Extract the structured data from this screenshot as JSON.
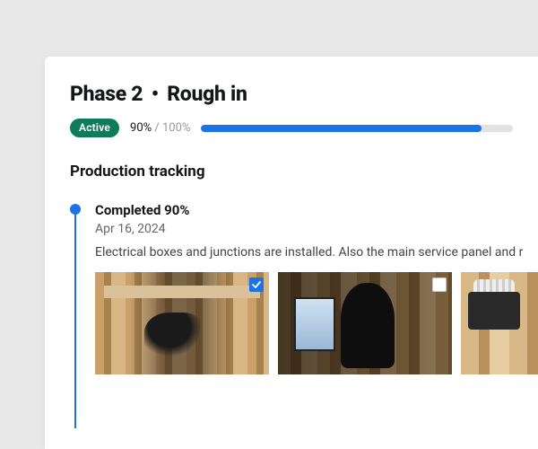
{
  "header": {
    "phase_label": "Phase 2",
    "separator": "•",
    "phase_name": "Rough in"
  },
  "status": {
    "badge": "Active",
    "current_pct": "90%",
    "slash": " / ",
    "target_pct": "100%",
    "progress_value": 90
  },
  "section": {
    "title": "Production tracking"
  },
  "timeline": {
    "entry": {
      "title": "Completed 90%",
      "date": "Apr 16, 2024",
      "description": "Electrical boxes and junctions are installed. Also the main service panel and r",
      "thumbs": [
        {
          "selected": true,
          "alt": "construction-photo-1"
        },
        {
          "selected": false,
          "alt": "construction-photo-2"
        },
        {
          "selected": false,
          "alt": "construction-photo-3"
        }
      ]
    }
  },
  "colors": {
    "accent": "#1a73e8",
    "badge_bg": "#0e7b5a"
  }
}
